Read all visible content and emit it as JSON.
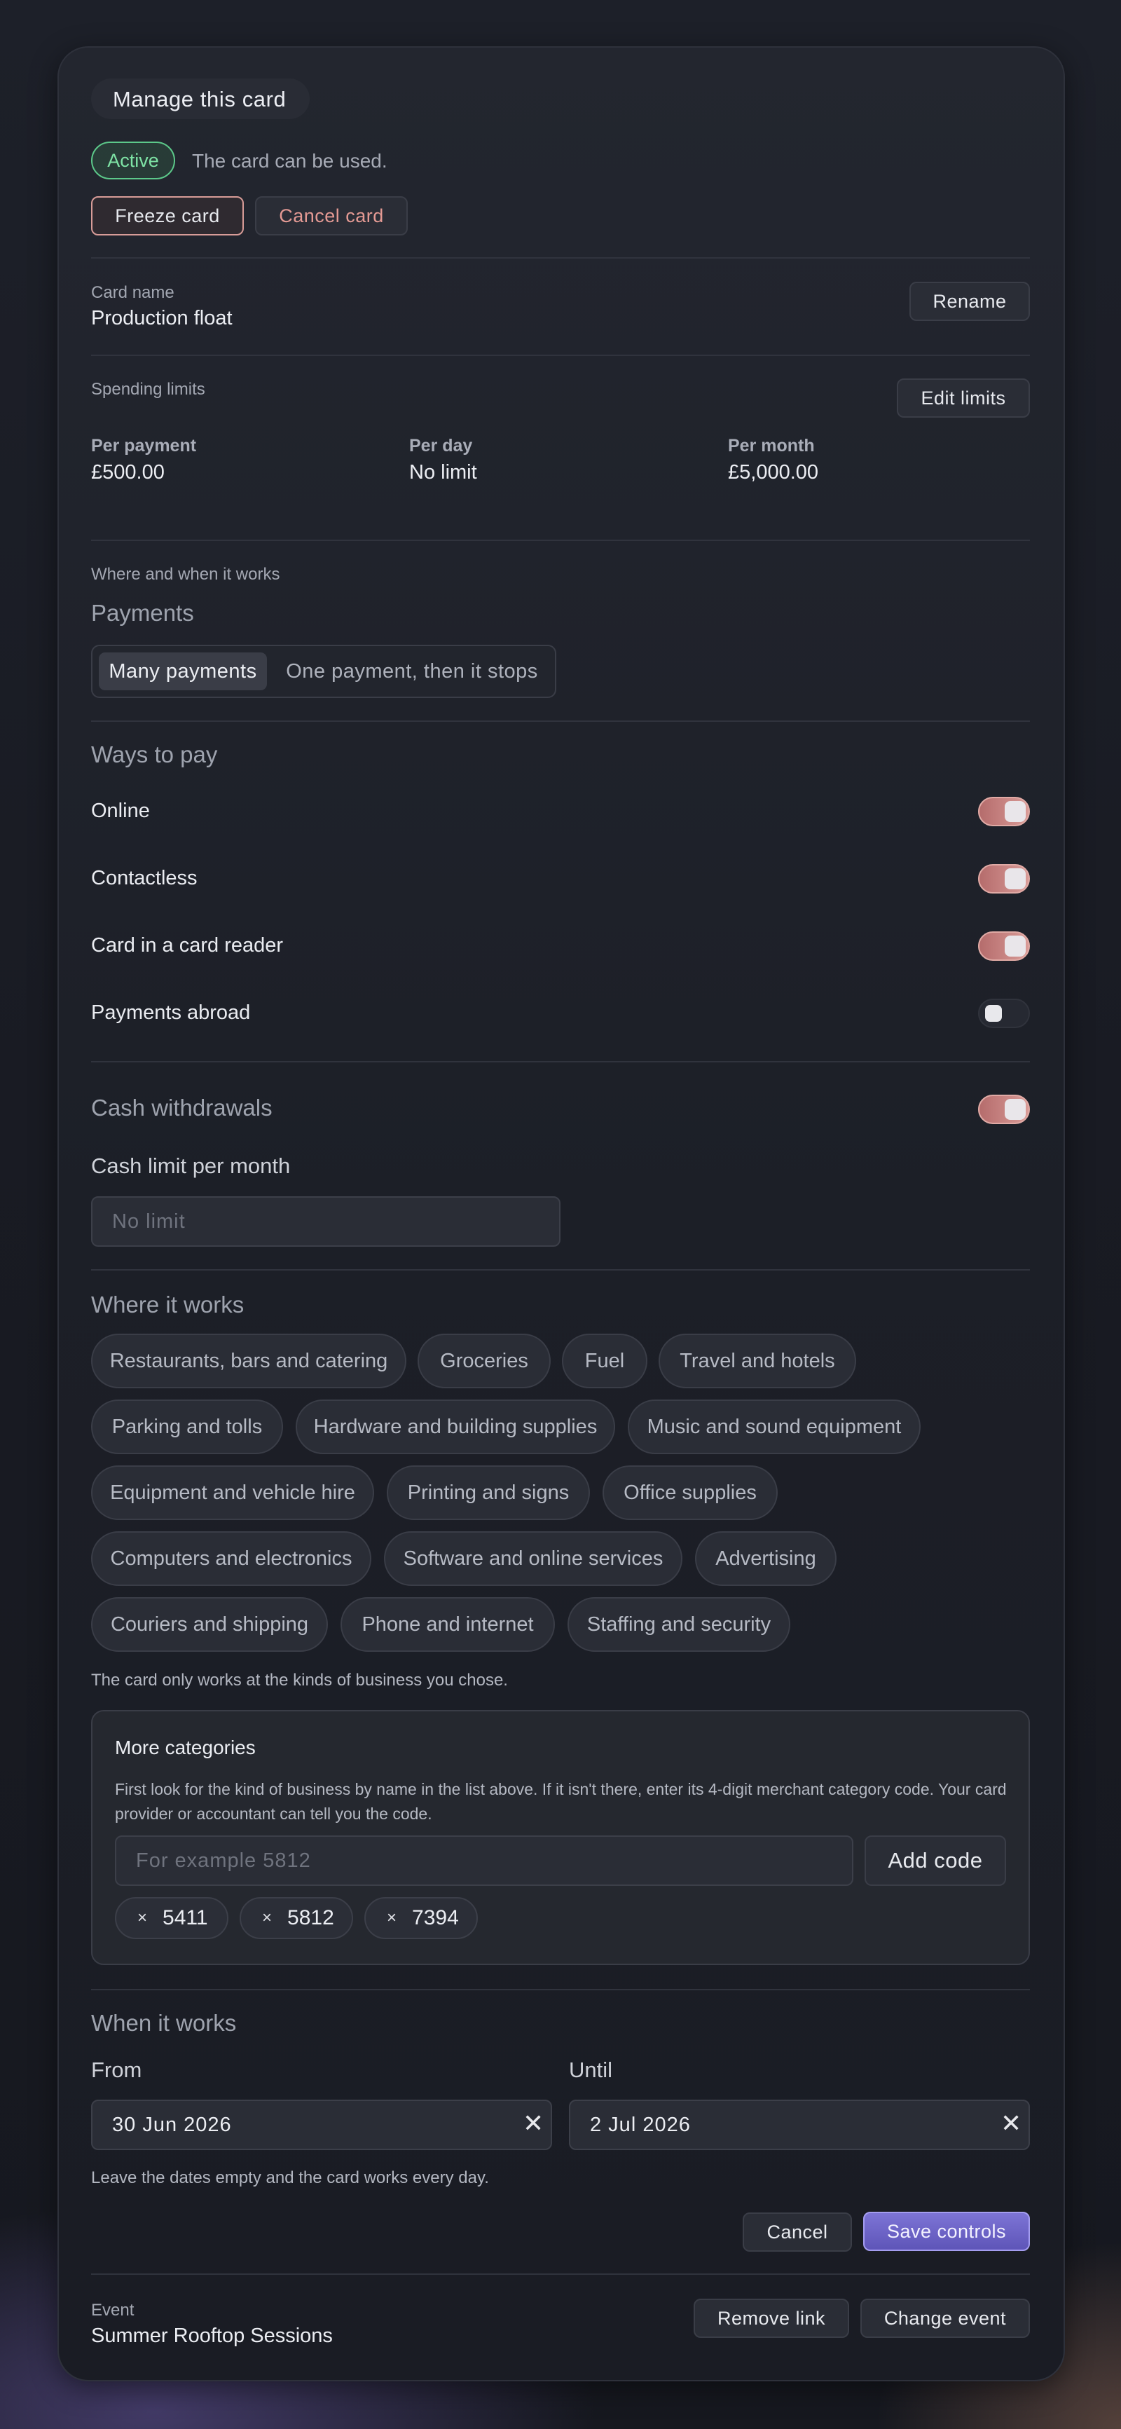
{
  "header": {
    "title": "Manage this card"
  },
  "status": {
    "badge": "Active",
    "text": "The card can be used.",
    "badge_color": "#6fdc97"
  },
  "actions": {
    "freeze": "Freeze card",
    "cancel_card": "Cancel card"
  },
  "card_name": {
    "label": "Card name",
    "value": "Production float",
    "rename": "Rename"
  },
  "spending": {
    "label": "Spending limits",
    "edit": "Edit limits",
    "limits": [
      {
        "label": "Per payment",
        "value": "£500.00"
      },
      {
        "label": "Per day",
        "value": "No limit"
      },
      {
        "label": "Per month",
        "value": "£5,000.00"
      }
    ]
  },
  "where_when": {
    "label": "Where and when it works",
    "payments_title": "Payments",
    "payment_modes": [
      "Many payments",
      "One payment, then it stops"
    ],
    "selected_mode": "Many payments"
  },
  "ways_to_pay": {
    "title": "Ways to pay",
    "items": [
      {
        "label": "Online",
        "on": true
      },
      {
        "label": "Contactless",
        "on": true
      },
      {
        "label": "Card in a card reader",
        "on": true
      },
      {
        "label": "Payments abroad",
        "on": false
      }
    ]
  },
  "cash": {
    "title": "Cash withdrawals",
    "on": true,
    "limit_label": "Cash limit per month",
    "limit_placeholder": "No limit"
  },
  "where_it_works": {
    "title": "Where it works",
    "categories": [
      [
        "Restaurants, bars and catering",
        "Groceries",
        "Fuel",
        "Travel and hotels"
      ],
      [
        "Parking and tolls",
        "Hardware and building supplies",
        "Music and sound equipment"
      ],
      [
        "Equipment and vehicle hire",
        "Printing and signs",
        "Office supplies"
      ],
      [
        "Computers and electronics",
        "Software and online services",
        "Advertising"
      ],
      [
        "Couriers and shipping",
        "Phone and internet",
        "Staffing and security"
      ]
    ],
    "note": "The card only works at the kinds of business you chose."
  },
  "more_categories": {
    "title": "More categories",
    "help": "First look for the kind of business by name in the list above. If it isn't there, enter its 4-digit merchant category code. Your card provider or accountant can tell you the code.",
    "placeholder": "For example 5812",
    "add_button": "Add code",
    "codes": [
      "5411",
      "5812",
      "7394"
    ],
    "remove_glyph": "×"
  },
  "when_it_works": {
    "title": "When it works",
    "from_label": "From",
    "from_value": "30 Jun 2026",
    "until_label": "Until",
    "until_value": "2 Jul 2026",
    "clear_glyph": "✕",
    "note": "Leave the dates empty and the card works every day."
  },
  "footer_actions": {
    "cancel": "Cancel",
    "save": "Save controls",
    "save_color": "#6b62c4"
  },
  "event": {
    "label": "Event",
    "value": "Summer Rooftop Sessions",
    "remove": "Remove link",
    "change": "Change event"
  }
}
